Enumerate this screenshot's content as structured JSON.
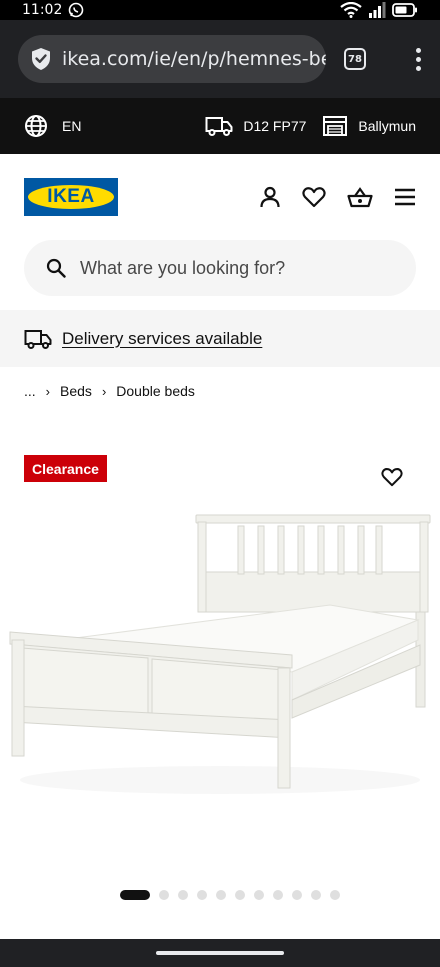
{
  "status_bar": {
    "time": "11:02"
  },
  "browser": {
    "url": "ikea.com/ie/en/p/hemnes-bed-frame",
    "tab_count": "78"
  },
  "top_strip": {
    "language": "EN",
    "postcode": "D12 FP77",
    "store": "Ballymun"
  },
  "header": {
    "logo_text": "IKEA"
  },
  "search": {
    "placeholder": "What are you looking for?"
  },
  "delivery": {
    "label": "Delivery services available"
  },
  "breadcrumb": {
    "ellipsis": "...",
    "items": [
      "Beds",
      "Double beds"
    ]
  },
  "product": {
    "badge": "Clearance",
    "badge_color": "#cc0008"
  },
  "carousel": {
    "total": 11,
    "active_index": 0
  },
  "colors": {
    "ikea_blue": "#0058a3",
    "ikea_yellow": "#ffdb00",
    "dark": "#111111"
  }
}
